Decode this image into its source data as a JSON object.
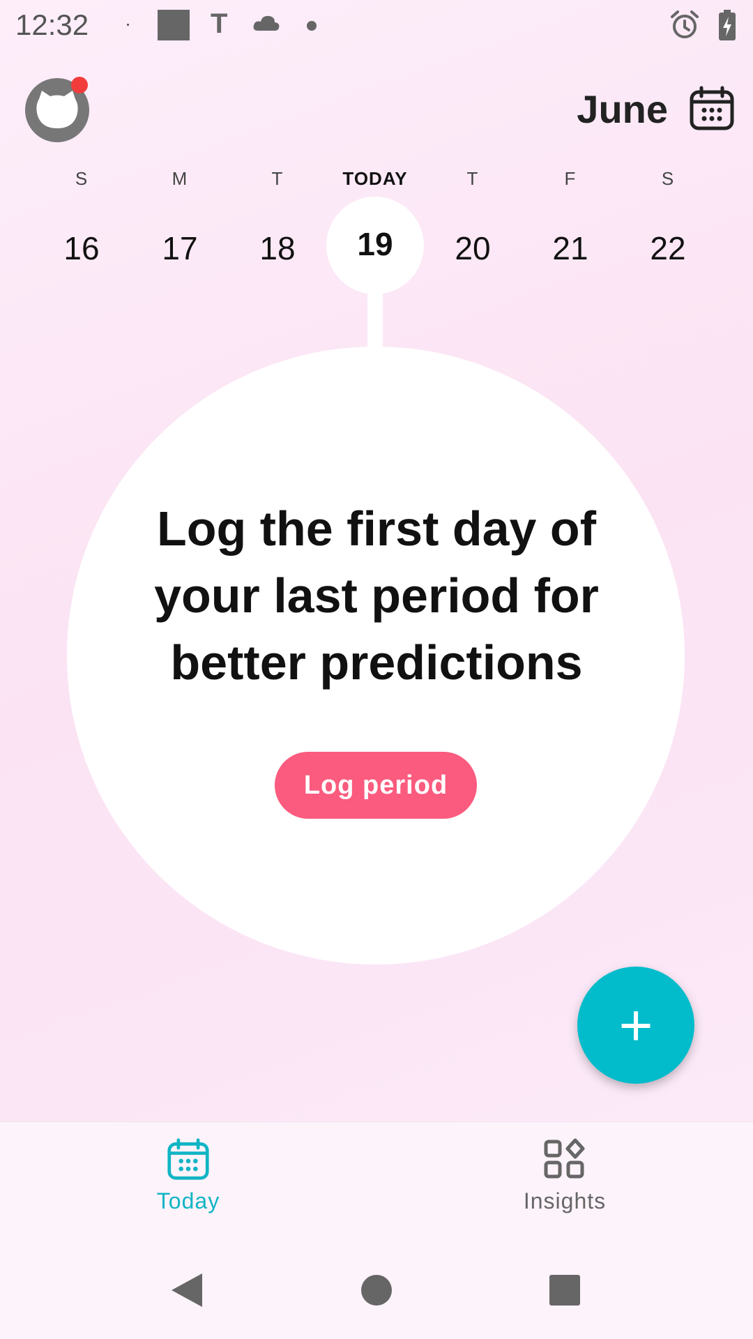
{
  "status_bar": {
    "time": "12:32",
    "icons": [
      "screen-record-icon",
      "t-icon",
      "cloud-icon",
      "dot-icon",
      "alarm-icon",
      "battery-charging-icon"
    ]
  },
  "header": {
    "month": "June",
    "avatar_icon": "cat-avatar-icon",
    "notification_dot_color": "#f23c3c",
    "calendar_icon": "calendar-icon"
  },
  "week": {
    "days": [
      {
        "label": "S",
        "num": "16"
      },
      {
        "label": "M",
        "num": "17"
      },
      {
        "label": "T",
        "num": "18"
      },
      {
        "label": "TODAY",
        "num": "19",
        "is_today": true
      },
      {
        "label": "T",
        "num": "20"
      },
      {
        "label": "F",
        "num": "21"
      },
      {
        "label": "S",
        "num": "22"
      }
    ]
  },
  "main": {
    "prompt": "Log the first day of your last period for better predictions",
    "log_button_label": "Log period",
    "accent_color": "#fa5b7e"
  },
  "fab": {
    "label": "+",
    "color": "#03bccb"
  },
  "bottom_nav": {
    "items": [
      {
        "label": "Today",
        "icon": "calendar-icon",
        "active": true
      },
      {
        "label": "Insights",
        "icon": "grid-icon",
        "active": false
      }
    ],
    "active_color": "#10b5c4"
  },
  "system_nav": {
    "icons": [
      "back-icon",
      "home-icon",
      "recents-icon"
    ]
  }
}
